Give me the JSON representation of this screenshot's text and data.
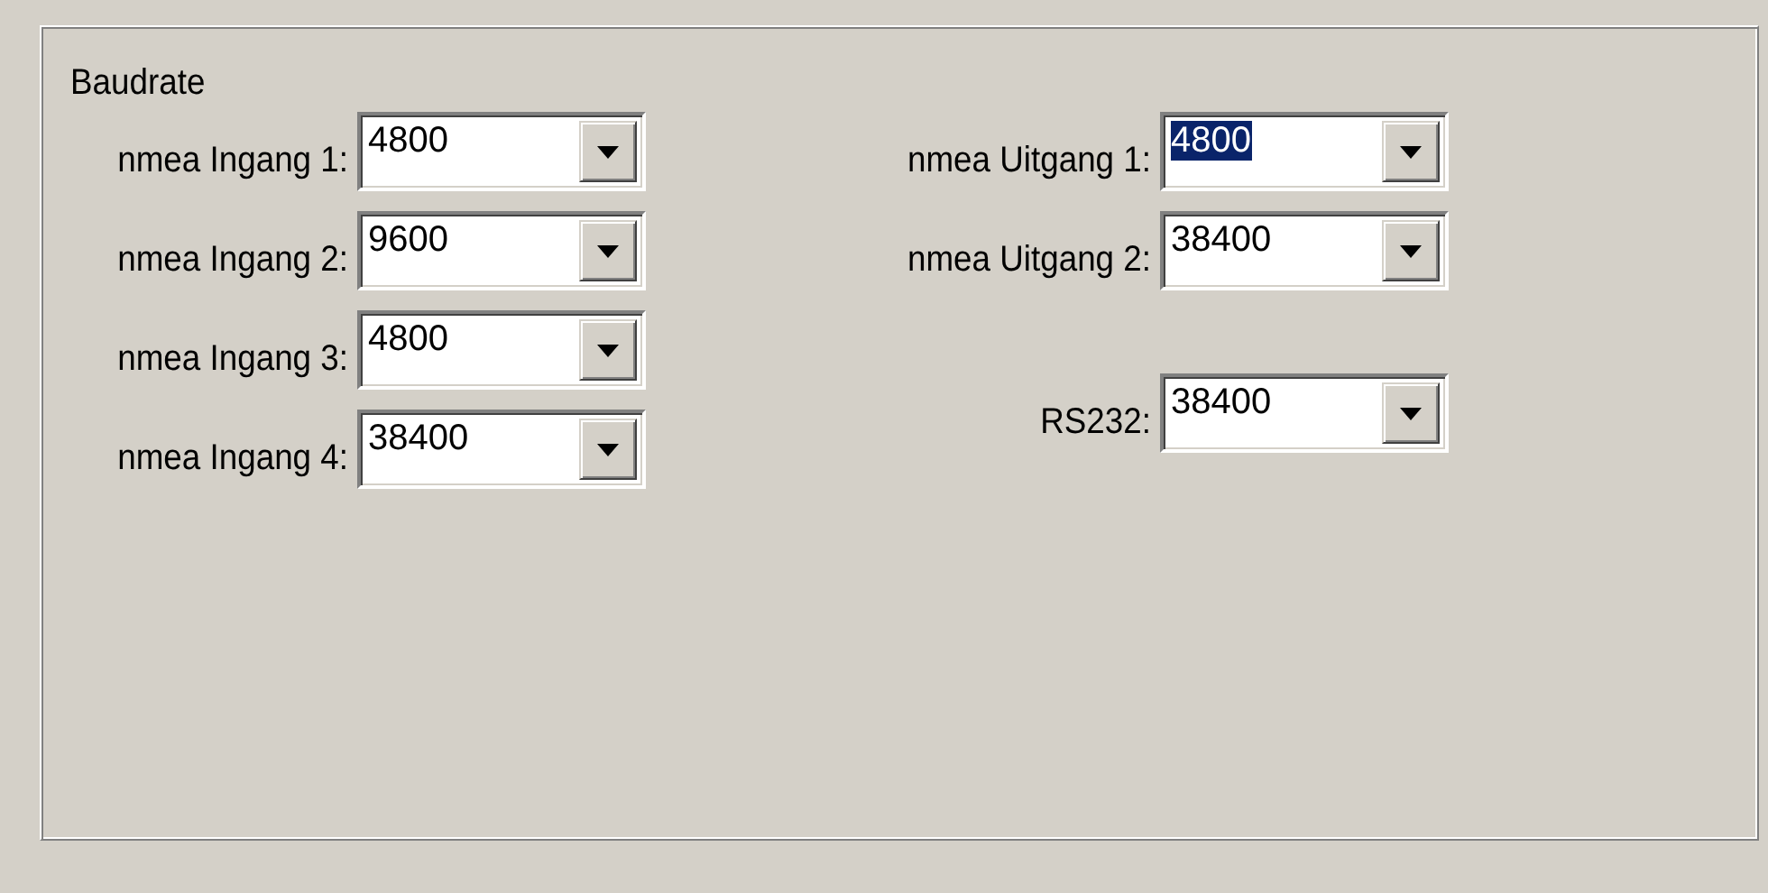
{
  "group": {
    "title": "Baudrate"
  },
  "inputs": [
    {
      "label": "nmea Ingang 1:",
      "value": "4800",
      "highlighted": false
    },
    {
      "label": "nmea Ingang 2:",
      "value": "9600",
      "highlighted": false
    },
    {
      "label": "nmea Ingang 3:",
      "value": "4800",
      "highlighted": false
    },
    {
      "label": "nmea Ingang 4:",
      "value": "38400",
      "highlighted": false
    }
  ],
  "outputs": [
    {
      "label": "nmea Uitgang 1:",
      "value": "4800",
      "highlighted": true
    },
    {
      "label": "nmea Uitgang 2:",
      "value": "38400",
      "highlighted": false
    }
  ],
  "rs232": {
    "label": "RS232:",
    "value": "38400",
    "highlighted": false
  }
}
